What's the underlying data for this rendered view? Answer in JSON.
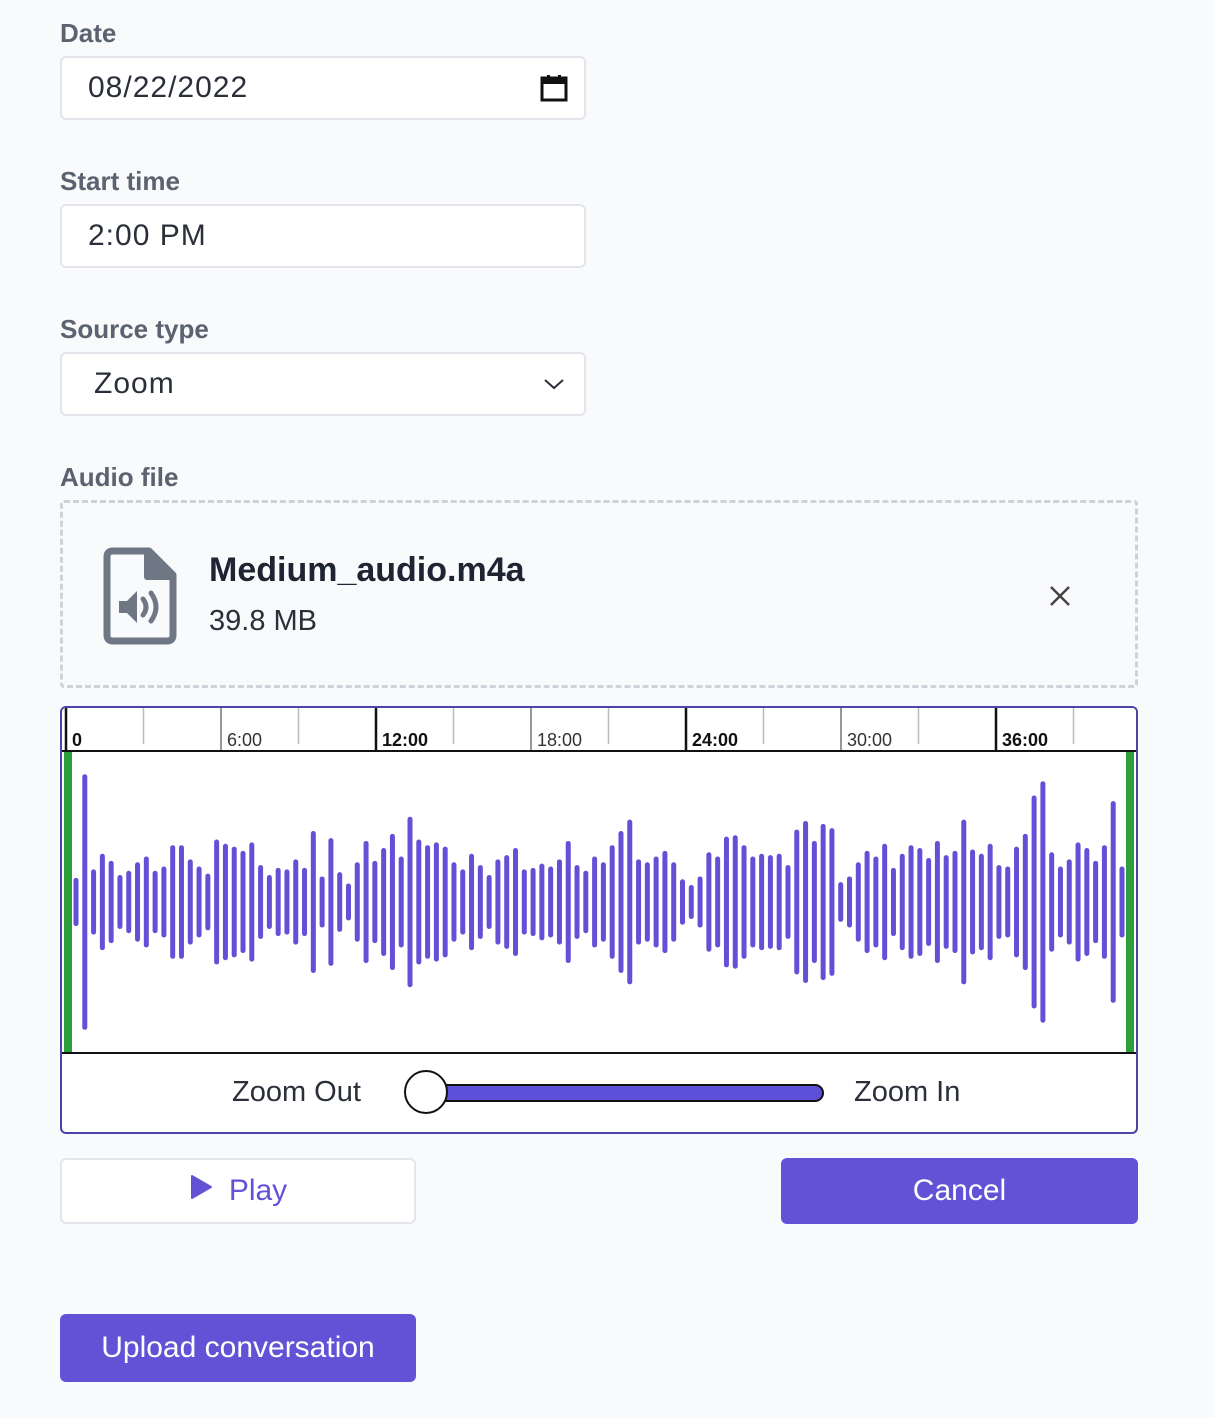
{
  "form": {
    "date_label": "Date",
    "date_value": "08/22/2022",
    "start_time_label": "Start time",
    "start_time_value": "2:00 PM",
    "source_type_label": "Source type",
    "source_type_value": "Zoom",
    "audio_file_label": "Audio file"
  },
  "file": {
    "name": "Medium_audio.m4a",
    "size": "39.8 MB",
    "icon": "audio-file-icon"
  },
  "timeline": {
    "ticks": [
      "0",
      "6:00",
      "12:00",
      "18:00",
      "24:00",
      "30:00",
      "36:00"
    ],
    "bold_ticks": [
      "0",
      "12:00",
      "24:00",
      "36:00"
    ]
  },
  "waveform": {
    "amplitudes": [
      0.17,
      0.9,
      0.23,
      0.34,
      0.29,
      0.19,
      0.22,
      0.28,
      0.32,
      0.22,
      0.25,
      0.4,
      0.4,
      0.3,
      0.25,
      0.2,
      0.44,
      0.41,
      0.39,
      0.36,
      0.42,
      0.26,
      0.19,
      0.24,
      0.23,
      0.3,
      0.24,
      0.5,
      0.18,
      0.45,
      0.21,
      0.13,
      0.28,
      0.43,
      0.29,
      0.38,
      0.48,
      0.32,
      0.6,
      0.44,
      0.4,
      0.42,
      0.39,
      0.28,
      0.23,
      0.34,
      0.26,
      0.19,
      0.3,
      0.33,
      0.38,
      0.23,
      0.24,
      0.27,
      0.25,
      0.3,
      0.43,
      0.26,
      0.22,
      0.32,
      0.28,
      0.4,
      0.5,
      0.58,
      0.3,
      0.28,
      0.32,
      0.36,
      0.28,
      0.16,
      0.12,
      0.18,
      0.35,
      0.32,
      0.46,
      0.47,
      0.4,
      0.32,
      0.34,
      0.33,
      0.34,
      0.26,
      0.51,
      0.57,
      0.43,
      0.55,
      0.52,
      0.14,
      0.18,
      0.28,
      0.36,
      0.32,
      0.41,
      0.24,
      0.34,
      0.4,
      0.38,
      0.31,
      0.43,
      0.33,
      0.36,
      0.58,
      0.37,
      0.34,
      0.41,
      0.26,
      0.25,
      0.39,
      0.48,
      0.75,
      0.85,
      0.35,
      0.25,
      0.3,
      0.42,
      0.38,
      0.29,
      0.4,
      0.71,
      0.25
    ],
    "bar_color": "#6350d6",
    "edge_color": "#2e9e3a"
  },
  "zoom": {
    "out_label": "Zoom Out",
    "in_label": "Zoom In",
    "level": 0
  },
  "buttons": {
    "play": "Play",
    "cancel": "Cancel",
    "upload": "Upload conversation"
  },
  "colors": {
    "accent": "#6352d6",
    "label": "#5b6270"
  }
}
